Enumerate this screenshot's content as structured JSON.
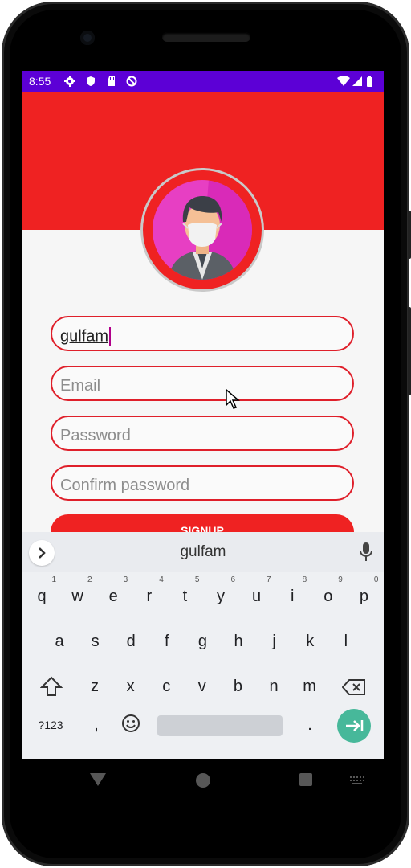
{
  "status_bar": {
    "time": "8:55"
  },
  "form": {
    "name_value": "gulfam",
    "email_placeholder": "Email",
    "password_placeholder": "Password",
    "confirm_placeholder": "Confirm password",
    "signup_label": "SIGNUP"
  },
  "keyboard": {
    "suggestion": "gulfam",
    "row1": [
      "q",
      "w",
      "e",
      "r",
      "t",
      "y",
      "u",
      "i",
      "o",
      "p"
    ],
    "row1_sup": [
      "1",
      "2",
      "3",
      "4",
      "5",
      "6",
      "7",
      "8",
      "9",
      "0"
    ],
    "row2": [
      "a",
      "s",
      "d",
      "f",
      "g",
      "h",
      "j",
      "k",
      "l"
    ],
    "row3": [
      "z",
      "x",
      "c",
      "v",
      "b",
      "n",
      "m"
    ],
    "symbols_key": "?123",
    "comma_key": ",",
    "period_key": "."
  },
  "colors": {
    "status_bar": "#5c00d6",
    "header": "#ef2222",
    "accent_border": "#df1f2a",
    "enter_key": "#47b89a"
  },
  "icons": [
    "settings-icon",
    "shield-icon",
    "sd-card-icon",
    "block-icon",
    "wifi-icon",
    "signal-icon",
    "battery-icon",
    "chevron-right-icon",
    "mic-icon",
    "shift-icon",
    "backspace-icon",
    "emoji-icon",
    "enter-icon",
    "nav-back-icon",
    "nav-home-icon",
    "nav-recents-icon",
    "keyboard-switch-icon"
  ]
}
